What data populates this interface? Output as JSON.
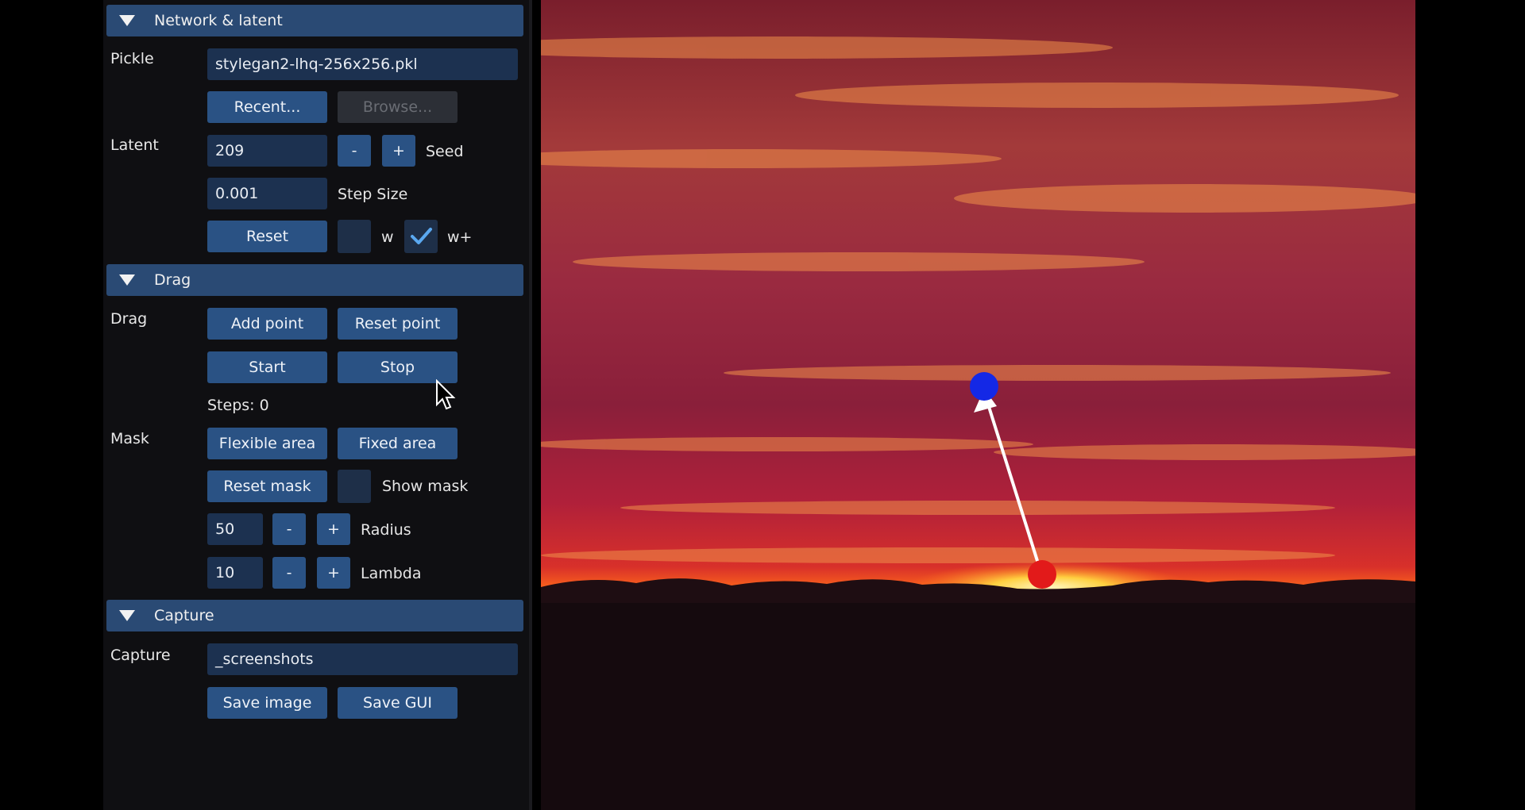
{
  "sections": {
    "network": "Network & latent",
    "drag": "Drag",
    "capture": "Capture"
  },
  "network": {
    "pickle_label": "Pickle",
    "pickle_value": "stylegan2-lhq-256x256.pkl",
    "recent_label": "Recent...",
    "browse_label": "Browse...",
    "latent_label": "Latent",
    "seed_value": "209",
    "minus_label": "-",
    "plus_label": "+",
    "seed_label": "Seed",
    "step_value": "0.001",
    "step_label": "Step Size",
    "reset_label": "Reset",
    "w_label": "w",
    "wplus_label": "w+",
    "w_checked": false,
    "wplus_checked": true
  },
  "drag": {
    "drag_label": "Drag",
    "add_point_label": "Add point",
    "reset_point_label": "Reset point",
    "start_label": "Start",
    "stop_label": "Stop",
    "steps_text": "Steps: 0",
    "mask_label": "Mask",
    "flexible_label": "Flexible area",
    "fixed_label": "Fixed area",
    "reset_mask_label": "Reset mask",
    "show_mask_label": "Show mask",
    "show_mask_checked": false,
    "radius_value": "50",
    "radius_label": "Radius",
    "lambda_value": "10",
    "lambda_label": "Lambda",
    "minus_label": "-",
    "plus_label": "+"
  },
  "capture": {
    "capture_label": "Capture",
    "path_value": "_screenshots",
    "save_image_label": "Save image",
    "save_gui_label": "Save GUI"
  },
  "colors": {
    "header": "#2a4a74",
    "button": "#2a5284",
    "input": "#1c3150",
    "handle_point": "#1428e6",
    "target_point": "#e21a1a"
  },
  "icons": {
    "collapse": "triangle-down-icon",
    "check": "checkmark-icon",
    "cursor": "mouse-cursor-icon"
  }
}
